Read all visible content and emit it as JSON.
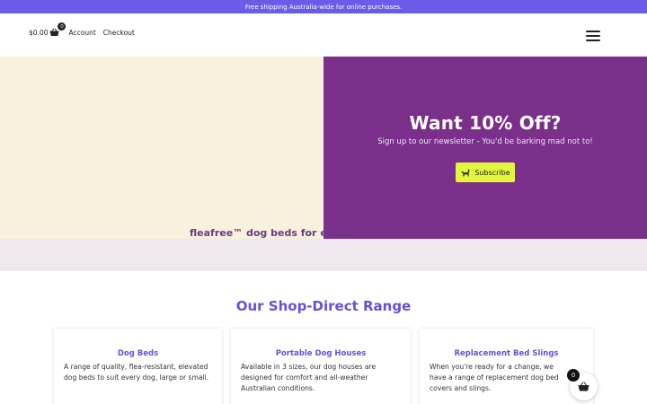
{
  "topbar": {
    "text": "Free shipping Australia-wide for online purchases."
  },
  "header": {
    "cart_price": "$0.00",
    "cart_count": "0",
    "links": [
      "Account",
      "Checkout"
    ],
    "menu_icon": "hamburger-icon",
    "cart_icon": "basket-icon"
  },
  "promo": {
    "title": "Want 10% Off?",
    "subtitle": "Sign up to our newsletter - You'd be barking mad not to!",
    "button_label": "Subscribe",
    "button_icon": "dog-icon"
  },
  "tagline": "fleafree™ dog beds for every",
  "range": {
    "title": "Our Shop-Direct Range",
    "cards": [
      {
        "title": "Dog Beds",
        "text": "A range of quality, flea-resistant, elevated dog beds to suit every dog, large or small."
      },
      {
        "title": "Portable Dog Houses",
        "text": "Available in 3 sizes, our dog houses are designed for comfort and all-weather Australian conditions."
      },
      {
        "title": "Replacement Bed Slings",
        "text": "When you're ready for a change, we have a range of replacement dog bed covers and slings."
      }
    ]
  },
  "floating_cart": {
    "count": "0",
    "icon": "basket-icon"
  },
  "colors": {
    "topbar": "#6b5ce7",
    "promo_bg": "#7a2f8a",
    "hero_left_bg": "#f8f1dd",
    "button_bg": "#e3f53c",
    "heading": "#6452d6",
    "band_bg": "#efe8ef"
  }
}
